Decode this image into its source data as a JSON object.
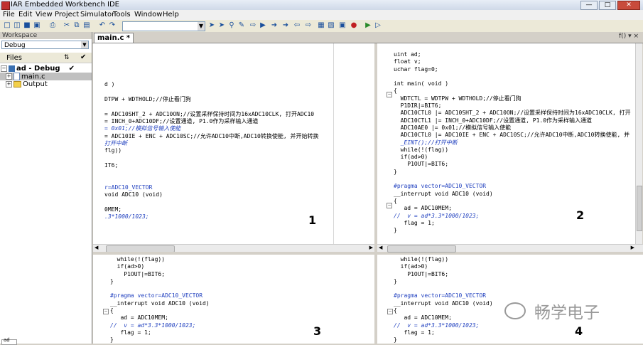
{
  "window": {
    "title": "IAR Embedded Workbench IDE"
  },
  "menu": [
    "File",
    "Edit",
    "View",
    "Project",
    "Simulator",
    "Tools",
    "Window",
    "Help"
  ],
  "workspace": {
    "title": "Workspace",
    "config": "Debug",
    "files_label": "Files",
    "project": "ad - Debug",
    "file": "main.c",
    "folder": "Output",
    "bottom_tab": "ad"
  },
  "editor": {
    "tab": "main.c *",
    "right_label": "f() ▾ ×"
  },
  "panes": [
    {
      "number": "1",
      "lines": [
        "",
        "",
        "",
        "",
        "",
        "d )",
        "",
        "DTPW + WDTHOLD;//停止看门狗",
        "",
        "= ADC10SHT_2 + ADC10ON;//设置采样保持时间为16xADC10CLK, 打开ADC10",
        "= INCH_0+ADC10DF;//设置通道, P1.0作为采样输入通道",
        "= 0x01;//模拟信号输入使能",
        "= ADC10IE + ENC + ADC10SC;//允许ADC10中断,ADC10转换使能, 并开始转换",
        "打开中断",
        "flg))",
        "",
        "IT6;",
        "",
        "",
        "r=ADC10_VECTOR",
        "void ADC10 (void)",
        "",
        "0MEM;",
        ".3*1000/1023;"
      ]
    },
    {
      "number": "2",
      "lines": [
        "uint ad;",
        "float v;",
        "uchar flag=0;",
        "",
        "int main( void )",
        "{",
        "  WDTCTL = WDTPW + WDTHOLD;//停止看门狗",
        "  P1DIR|=BIT6;",
        "  ADC10CTL0 |= ADC10SHT_2 + ADC10ON;//设置采样保持时间为16xADC10CLK, 打开",
        "  ADC10CTL1 |= INCH_0+ADC10DF;//设置通道, P1.0作为采样输入通道",
        "  ADC10AE0 |= 0x01;//模拟信号输入使能",
        "  ADC10CTL0 |= ADC10IE + ENC + ADC10SC;//允许ADC10中断,ADC10转换使能, 并",
        "  _EINT();//打开中断",
        "  while(!(flag))",
        "  if(ad>0)",
        "    P1OUT|=BIT6;",
        "}",
        "",
        "#pragma vector=ADC10_VECTOR",
        "__interrupt void ADC10 (void)",
        "{",
        "   ad = ADC10MEM;",
        "//  v = ad*3.3*1000/1023;",
        "   flag = 1;",
        "}"
      ]
    },
    {
      "number": "3",
      "lines": [
        "  while(!(flag))",
        "  if(ad>0)",
        "    P1OUT|=BIT6;",
        "}",
        "",
        "#pragma vector=ADC10_VECTOR",
        "__interrupt void ADC10 (void)",
        "{",
        "   ad = ADC10MEM;",
        "//  v = ad*3.3*1000/1023;",
        "   flag = 1;",
        "}"
      ]
    },
    {
      "number": "4",
      "lines": [
        "  while(!(flag))",
        "  if(ad>0)",
        "    P1OUT|=BIT6;",
        "}",
        "",
        "#pragma vector=ADC10_VECTOR",
        "__interrupt void ADC10 (void)",
        "{",
        "   ad = ADC10MEM;",
        "//  v = ad*3.3*1000/1023;",
        "   flag = 1;",
        "}"
      ]
    }
  ],
  "watermark": "畅学电子",
  "colors": {
    "comment": "#1f3fbf",
    "accent": "#c03030"
  }
}
